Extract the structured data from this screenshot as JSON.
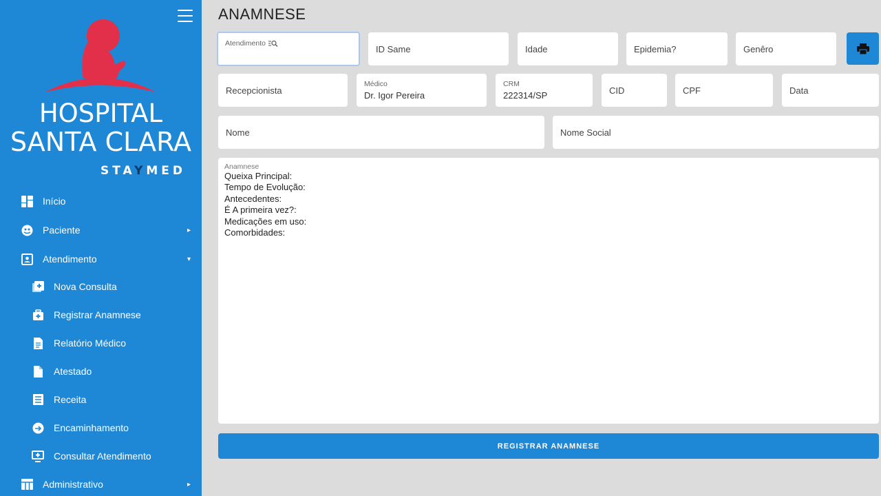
{
  "sidebar": {
    "brand_line1": "HOSPITAL",
    "brand_line2": "SANTA CLARA",
    "sub_brand_a": "STA",
    "sub_brand_b": "Y",
    "sub_brand_c": "MED",
    "nav": [
      {
        "label": "Início",
        "icon": "dashboard-icon"
      },
      {
        "label": "Paciente",
        "icon": "patient-icon",
        "caret": "▸"
      },
      {
        "label": "Atendimento",
        "icon": "contact-card-icon",
        "caret": "▾"
      },
      {
        "label": "Nova Consulta",
        "icon": "add-box-icon"
      },
      {
        "label": "Registrar Anamnese",
        "icon": "medical-bag-icon"
      },
      {
        "label": "Relatório Médico",
        "icon": "document-icon"
      },
      {
        "label": "Atestado",
        "icon": "file-icon"
      },
      {
        "label": "Receita",
        "icon": "list-icon"
      },
      {
        "label": "Encaminhamento",
        "icon": "referral-icon"
      },
      {
        "label": "Consultar Atendimento",
        "icon": "monitor-add-icon"
      },
      {
        "label": "Administrativo",
        "icon": "table-icon",
        "caret": "▸"
      }
    ]
  },
  "page": {
    "title": "ANAMNESE"
  },
  "row1": {
    "atendimento_label": "Atendimento",
    "id_same": "ID Same",
    "idade": "Idade",
    "epidemia": "Epidemia?",
    "genero": "Genêro"
  },
  "row2": {
    "recepcionista": "Recepcionista",
    "medico_label": "Médico",
    "medico_value": "Dr. Igor Pereira",
    "crm_label": "CRM",
    "crm_value": "222314/SP",
    "cid": "CID",
    "cpf": "CPF",
    "data": "Data"
  },
  "row3": {
    "nome": "Nome",
    "nome_social": "Nome Social"
  },
  "anamnese": {
    "label": "Anamnese",
    "lines": [
      "Queixa Principal:",
      "Tempo de Evolução:",
      "Antecedentes:",
      "É A primeira vez?:",
      "Medicações em uso:",
      "Comorbidades:"
    ]
  },
  "submit_label": "REGISTRAR ANAMNESE",
  "colors": {
    "sidebar": "#1e88d6",
    "logo_red": "#e2304a",
    "background": "#dcdcdc"
  }
}
